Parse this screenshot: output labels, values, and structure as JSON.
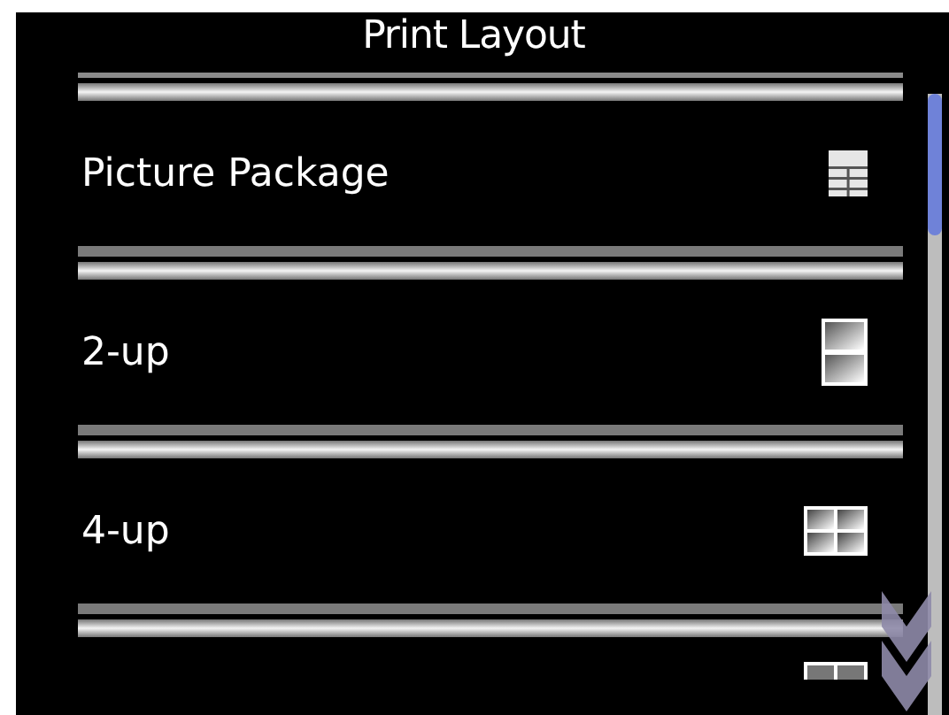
{
  "title": "Print Layout",
  "items": [
    {
      "label": "Picture Package",
      "kind": "package"
    },
    {
      "label": "2-up",
      "kind": "two"
    },
    {
      "label": "4-up",
      "kind": "four"
    },
    {
      "kind": "partial"
    }
  ]
}
